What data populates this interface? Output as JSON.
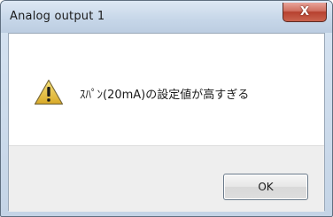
{
  "window": {
    "title": "Analog output 1",
    "close_glyph": "X"
  },
  "dialog": {
    "icon": "warning-icon",
    "message": "ｽﾊﾟﾝ(20mA)の設定値が高すぎる"
  },
  "buttons": {
    "ok_label": "OK"
  },
  "colors": {
    "titlebar": "#c6d6e8",
    "close_button": "#c9634f",
    "button_area": "#eeeeee",
    "warning_yellow": "#e9c43a"
  }
}
